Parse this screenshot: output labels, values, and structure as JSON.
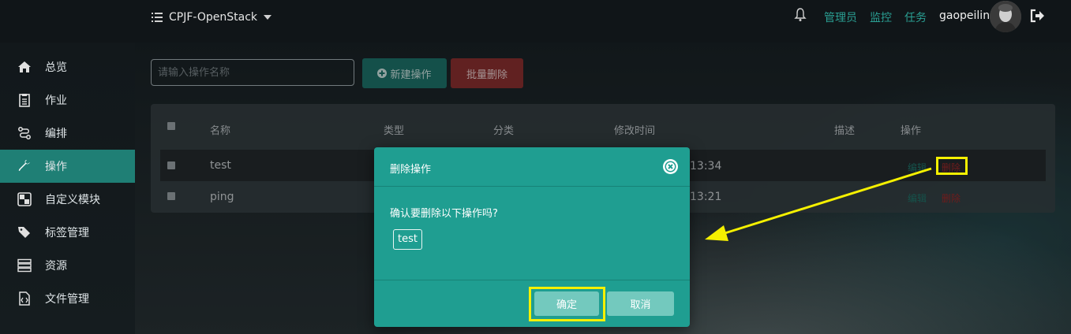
{
  "topbar": {
    "project_name": "CPJF-OpenStack",
    "links": [
      "管理员",
      "监控",
      "任务"
    ],
    "username": "gaopeilin"
  },
  "sidebar": {
    "items": [
      {
        "label": "总览",
        "icon": "home-icon"
      },
      {
        "label": "作业",
        "icon": "clipboard-icon"
      },
      {
        "label": "编排",
        "icon": "route-icon"
      },
      {
        "label": "操作",
        "icon": "wrench-icon",
        "active": true
      },
      {
        "label": "自定义模块",
        "icon": "module-icon"
      },
      {
        "label": "标签管理",
        "icon": "tags-icon"
      },
      {
        "label": "资源",
        "icon": "server-icon"
      },
      {
        "label": "文件管理",
        "icon": "file-code-icon"
      }
    ]
  },
  "toolbar": {
    "search_placeholder": "请输入操作名称",
    "new_label": "新建操作",
    "batch_delete_label": "批量删除"
  },
  "table": {
    "columns": [
      "名称",
      "类型",
      "分类",
      "修改时间",
      "描述",
      "操作"
    ],
    "rows": [
      {
        "name": "test",
        "time": "13:34",
        "edit": "编辑",
        "delete": "删除"
      },
      {
        "name": "ping",
        "time": "13:21",
        "edit": "编辑",
        "delete": "删除"
      }
    ]
  },
  "modal": {
    "title": "删除操作",
    "question": "确认要删除以下操作吗?",
    "item": "test",
    "confirm_label": "确定",
    "cancel_label": "取消"
  },
  "colors": {
    "accent": "#1f9e91",
    "danger": "#8f3131",
    "highlight": "#f5f000"
  }
}
